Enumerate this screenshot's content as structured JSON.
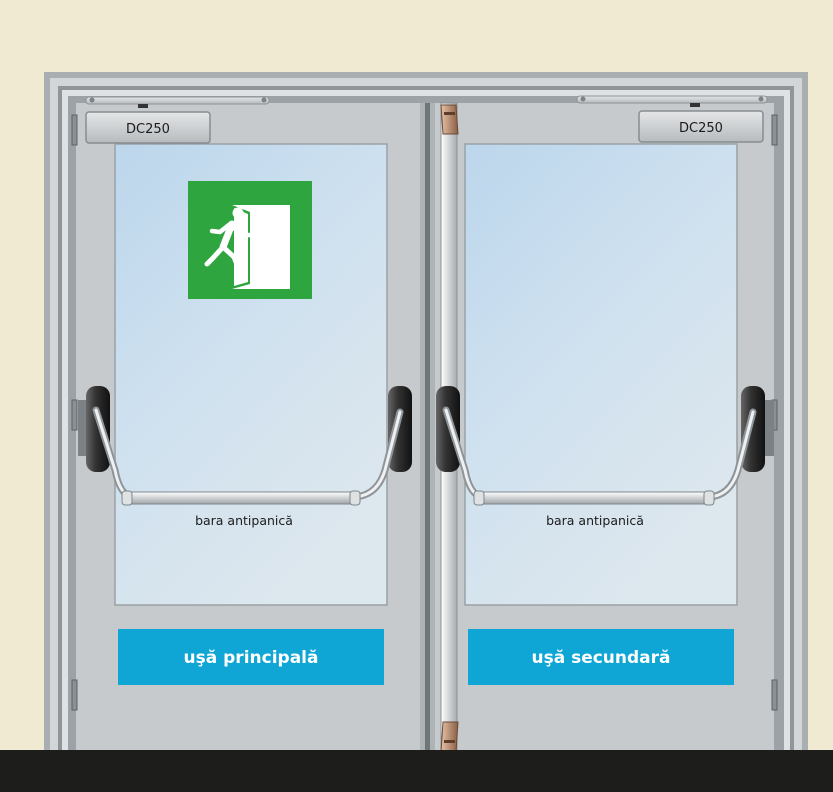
{
  "closer_left_label": "DC250",
  "closer_right_label": "DC250",
  "left_bar_label": "bara antipanică",
  "right_bar_label": "bara antipanică",
  "left_door_sign": "uşă principală",
  "right_door_sign": "uşă secundară",
  "colors": {
    "wall": "#f1ead3",
    "floor": "#1d1d1b",
    "sign_blue": "#0fa6d6",
    "exit_green": "#2ea53f",
    "door_gray": "#c7cbce",
    "glass": "#c5dcee"
  },
  "icons": [
    "running-man-exit-icon",
    "door-closer-icon",
    "panic-bar-icon",
    "hinge-icon"
  ]
}
